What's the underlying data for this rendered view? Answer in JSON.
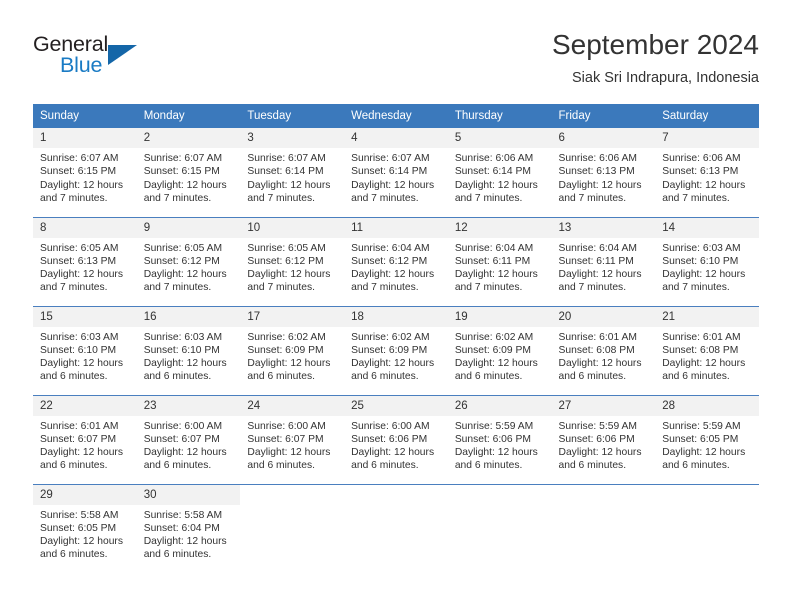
{
  "logo": {
    "word_top": "General",
    "word_bottom": "Blue",
    "triangle_color": "#1466a8",
    "blue_color": "#1a7bc4"
  },
  "header": {
    "title": "September 2024",
    "subtitle": "Siak Sri Indrapura, Indonesia"
  },
  "theme": {
    "header_row_color": "#3b79bc",
    "daynum_band_color": "#f2f2f2",
    "row_divider_color": "#4a7fbf",
    "text_color": "#333333"
  },
  "weekdays": [
    "Sunday",
    "Monday",
    "Tuesday",
    "Wednesday",
    "Thursday",
    "Friday",
    "Saturday"
  ],
  "labels": {
    "sunrise_prefix": "Sunrise:",
    "sunset_prefix": "Sunset:",
    "daylight_prefix": "Daylight:"
  },
  "weeks": [
    [
      {
        "day": "1",
        "sunrise": "Sunrise: 6:07 AM",
        "sunset": "Sunset: 6:15 PM",
        "daylight_line1": "Daylight: 12 hours",
        "daylight_line2": "and 7 minutes."
      },
      {
        "day": "2",
        "sunrise": "Sunrise: 6:07 AM",
        "sunset": "Sunset: 6:15 PM",
        "daylight_line1": "Daylight: 12 hours",
        "daylight_line2": "and 7 minutes."
      },
      {
        "day": "3",
        "sunrise": "Sunrise: 6:07 AM",
        "sunset": "Sunset: 6:14 PM",
        "daylight_line1": "Daylight: 12 hours",
        "daylight_line2": "and 7 minutes."
      },
      {
        "day": "4",
        "sunrise": "Sunrise: 6:07 AM",
        "sunset": "Sunset: 6:14 PM",
        "daylight_line1": "Daylight: 12 hours",
        "daylight_line2": "and 7 minutes."
      },
      {
        "day": "5",
        "sunrise": "Sunrise: 6:06 AM",
        "sunset": "Sunset: 6:14 PM",
        "daylight_line1": "Daylight: 12 hours",
        "daylight_line2": "and 7 minutes."
      },
      {
        "day": "6",
        "sunrise": "Sunrise: 6:06 AM",
        "sunset": "Sunset: 6:13 PM",
        "daylight_line1": "Daylight: 12 hours",
        "daylight_line2": "and 7 minutes."
      },
      {
        "day": "7",
        "sunrise": "Sunrise: 6:06 AM",
        "sunset": "Sunset: 6:13 PM",
        "daylight_line1": "Daylight: 12 hours",
        "daylight_line2": "and 7 minutes."
      }
    ],
    [
      {
        "day": "8",
        "sunrise": "Sunrise: 6:05 AM",
        "sunset": "Sunset: 6:13 PM",
        "daylight_line1": "Daylight: 12 hours",
        "daylight_line2": "and 7 minutes."
      },
      {
        "day": "9",
        "sunrise": "Sunrise: 6:05 AM",
        "sunset": "Sunset: 6:12 PM",
        "daylight_line1": "Daylight: 12 hours",
        "daylight_line2": "and 7 minutes."
      },
      {
        "day": "10",
        "sunrise": "Sunrise: 6:05 AM",
        "sunset": "Sunset: 6:12 PM",
        "daylight_line1": "Daylight: 12 hours",
        "daylight_line2": "and 7 minutes."
      },
      {
        "day": "11",
        "sunrise": "Sunrise: 6:04 AM",
        "sunset": "Sunset: 6:12 PM",
        "daylight_line1": "Daylight: 12 hours",
        "daylight_line2": "and 7 minutes."
      },
      {
        "day": "12",
        "sunrise": "Sunrise: 6:04 AM",
        "sunset": "Sunset: 6:11 PM",
        "daylight_line1": "Daylight: 12 hours",
        "daylight_line2": "and 7 minutes."
      },
      {
        "day": "13",
        "sunrise": "Sunrise: 6:04 AM",
        "sunset": "Sunset: 6:11 PM",
        "daylight_line1": "Daylight: 12 hours",
        "daylight_line2": "and 7 minutes."
      },
      {
        "day": "14",
        "sunrise": "Sunrise: 6:03 AM",
        "sunset": "Sunset: 6:10 PM",
        "daylight_line1": "Daylight: 12 hours",
        "daylight_line2": "and 7 minutes."
      }
    ],
    [
      {
        "day": "15",
        "sunrise": "Sunrise: 6:03 AM",
        "sunset": "Sunset: 6:10 PM",
        "daylight_line1": "Daylight: 12 hours",
        "daylight_line2": "and 6 minutes."
      },
      {
        "day": "16",
        "sunrise": "Sunrise: 6:03 AM",
        "sunset": "Sunset: 6:10 PM",
        "daylight_line1": "Daylight: 12 hours",
        "daylight_line2": "and 6 minutes."
      },
      {
        "day": "17",
        "sunrise": "Sunrise: 6:02 AM",
        "sunset": "Sunset: 6:09 PM",
        "daylight_line1": "Daylight: 12 hours",
        "daylight_line2": "and 6 minutes."
      },
      {
        "day": "18",
        "sunrise": "Sunrise: 6:02 AM",
        "sunset": "Sunset: 6:09 PM",
        "daylight_line1": "Daylight: 12 hours",
        "daylight_line2": "and 6 minutes."
      },
      {
        "day": "19",
        "sunrise": "Sunrise: 6:02 AM",
        "sunset": "Sunset: 6:09 PM",
        "daylight_line1": "Daylight: 12 hours",
        "daylight_line2": "and 6 minutes."
      },
      {
        "day": "20",
        "sunrise": "Sunrise: 6:01 AM",
        "sunset": "Sunset: 6:08 PM",
        "daylight_line1": "Daylight: 12 hours",
        "daylight_line2": "and 6 minutes."
      },
      {
        "day": "21",
        "sunrise": "Sunrise: 6:01 AM",
        "sunset": "Sunset: 6:08 PM",
        "daylight_line1": "Daylight: 12 hours",
        "daylight_line2": "and 6 minutes."
      }
    ],
    [
      {
        "day": "22",
        "sunrise": "Sunrise: 6:01 AM",
        "sunset": "Sunset: 6:07 PM",
        "daylight_line1": "Daylight: 12 hours",
        "daylight_line2": "and 6 minutes."
      },
      {
        "day": "23",
        "sunrise": "Sunrise: 6:00 AM",
        "sunset": "Sunset: 6:07 PM",
        "daylight_line1": "Daylight: 12 hours",
        "daylight_line2": "and 6 minutes."
      },
      {
        "day": "24",
        "sunrise": "Sunrise: 6:00 AM",
        "sunset": "Sunset: 6:07 PM",
        "daylight_line1": "Daylight: 12 hours",
        "daylight_line2": "and 6 minutes."
      },
      {
        "day": "25",
        "sunrise": "Sunrise: 6:00 AM",
        "sunset": "Sunset: 6:06 PM",
        "daylight_line1": "Daylight: 12 hours",
        "daylight_line2": "and 6 minutes."
      },
      {
        "day": "26",
        "sunrise": "Sunrise: 5:59 AM",
        "sunset": "Sunset: 6:06 PM",
        "daylight_line1": "Daylight: 12 hours",
        "daylight_line2": "and 6 minutes."
      },
      {
        "day": "27",
        "sunrise": "Sunrise: 5:59 AM",
        "sunset": "Sunset: 6:06 PM",
        "daylight_line1": "Daylight: 12 hours",
        "daylight_line2": "and 6 minutes."
      },
      {
        "day": "28",
        "sunrise": "Sunrise: 5:59 AM",
        "sunset": "Sunset: 6:05 PM",
        "daylight_line1": "Daylight: 12 hours",
        "daylight_line2": "and 6 minutes."
      }
    ],
    [
      {
        "day": "29",
        "sunrise": "Sunrise: 5:58 AM",
        "sunset": "Sunset: 6:05 PM",
        "daylight_line1": "Daylight: 12 hours",
        "daylight_line2": "and 6 minutes."
      },
      {
        "day": "30",
        "sunrise": "Sunrise: 5:58 AM",
        "sunset": "Sunset: 6:04 PM",
        "daylight_line1": "Daylight: 12 hours",
        "daylight_line2": "and 6 minutes."
      },
      {
        "day": "",
        "sunrise": "",
        "sunset": "",
        "daylight_line1": "",
        "daylight_line2": ""
      },
      {
        "day": "",
        "sunrise": "",
        "sunset": "",
        "daylight_line1": "",
        "daylight_line2": ""
      },
      {
        "day": "",
        "sunrise": "",
        "sunset": "",
        "daylight_line1": "",
        "daylight_line2": ""
      },
      {
        "day": "",
        "sunrise": "",
        "sunset": "",
        "daylight_line1": "",
        "daylight_line2": ""
      },
      {
        "day": "",
        "sunrise": "",
        "sunset": "",
        "daylight_line1": "",
        "daylight_line2": ""
      }
    ]
  ]
}
